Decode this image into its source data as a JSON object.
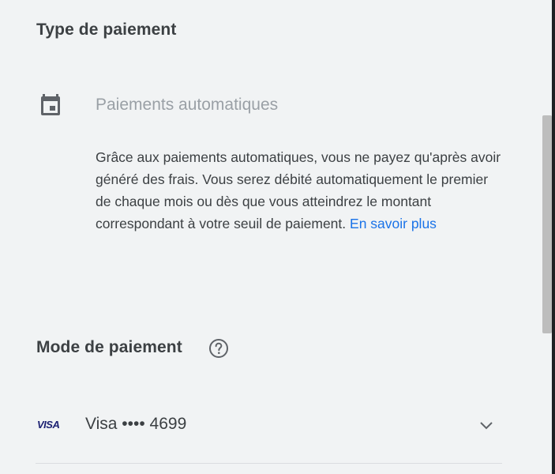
{
  "payment_type": {
    "title": "Type de paiement",
    "option_label": "Paiements automatiques",
    "icon": "calendar-icon",
    "description": "Grâce aux paiements automatiques, vous ne payez qu'après avoir généré des frais. Vous serez débité automatiquement le premier de chaque mois ou dès que vous atteindrez le montant correspondant à votre seuil de paiement.",
    "learn_more": "En savoir plus"
  },
  "payment_method": {
    "title": "Mode de paiement",
    "help_icon": "help-circle-icon",
    "card_brand": "VISA",
    "card_label": "Visa •••• 4699",
    "expand_icon": "chevron-down-icon"
  },
  "colors": {
    "link": "#1a73e8",
    "background": "#f1f3f4",
    "muted_text": "#9aa0a6"
  }
}
